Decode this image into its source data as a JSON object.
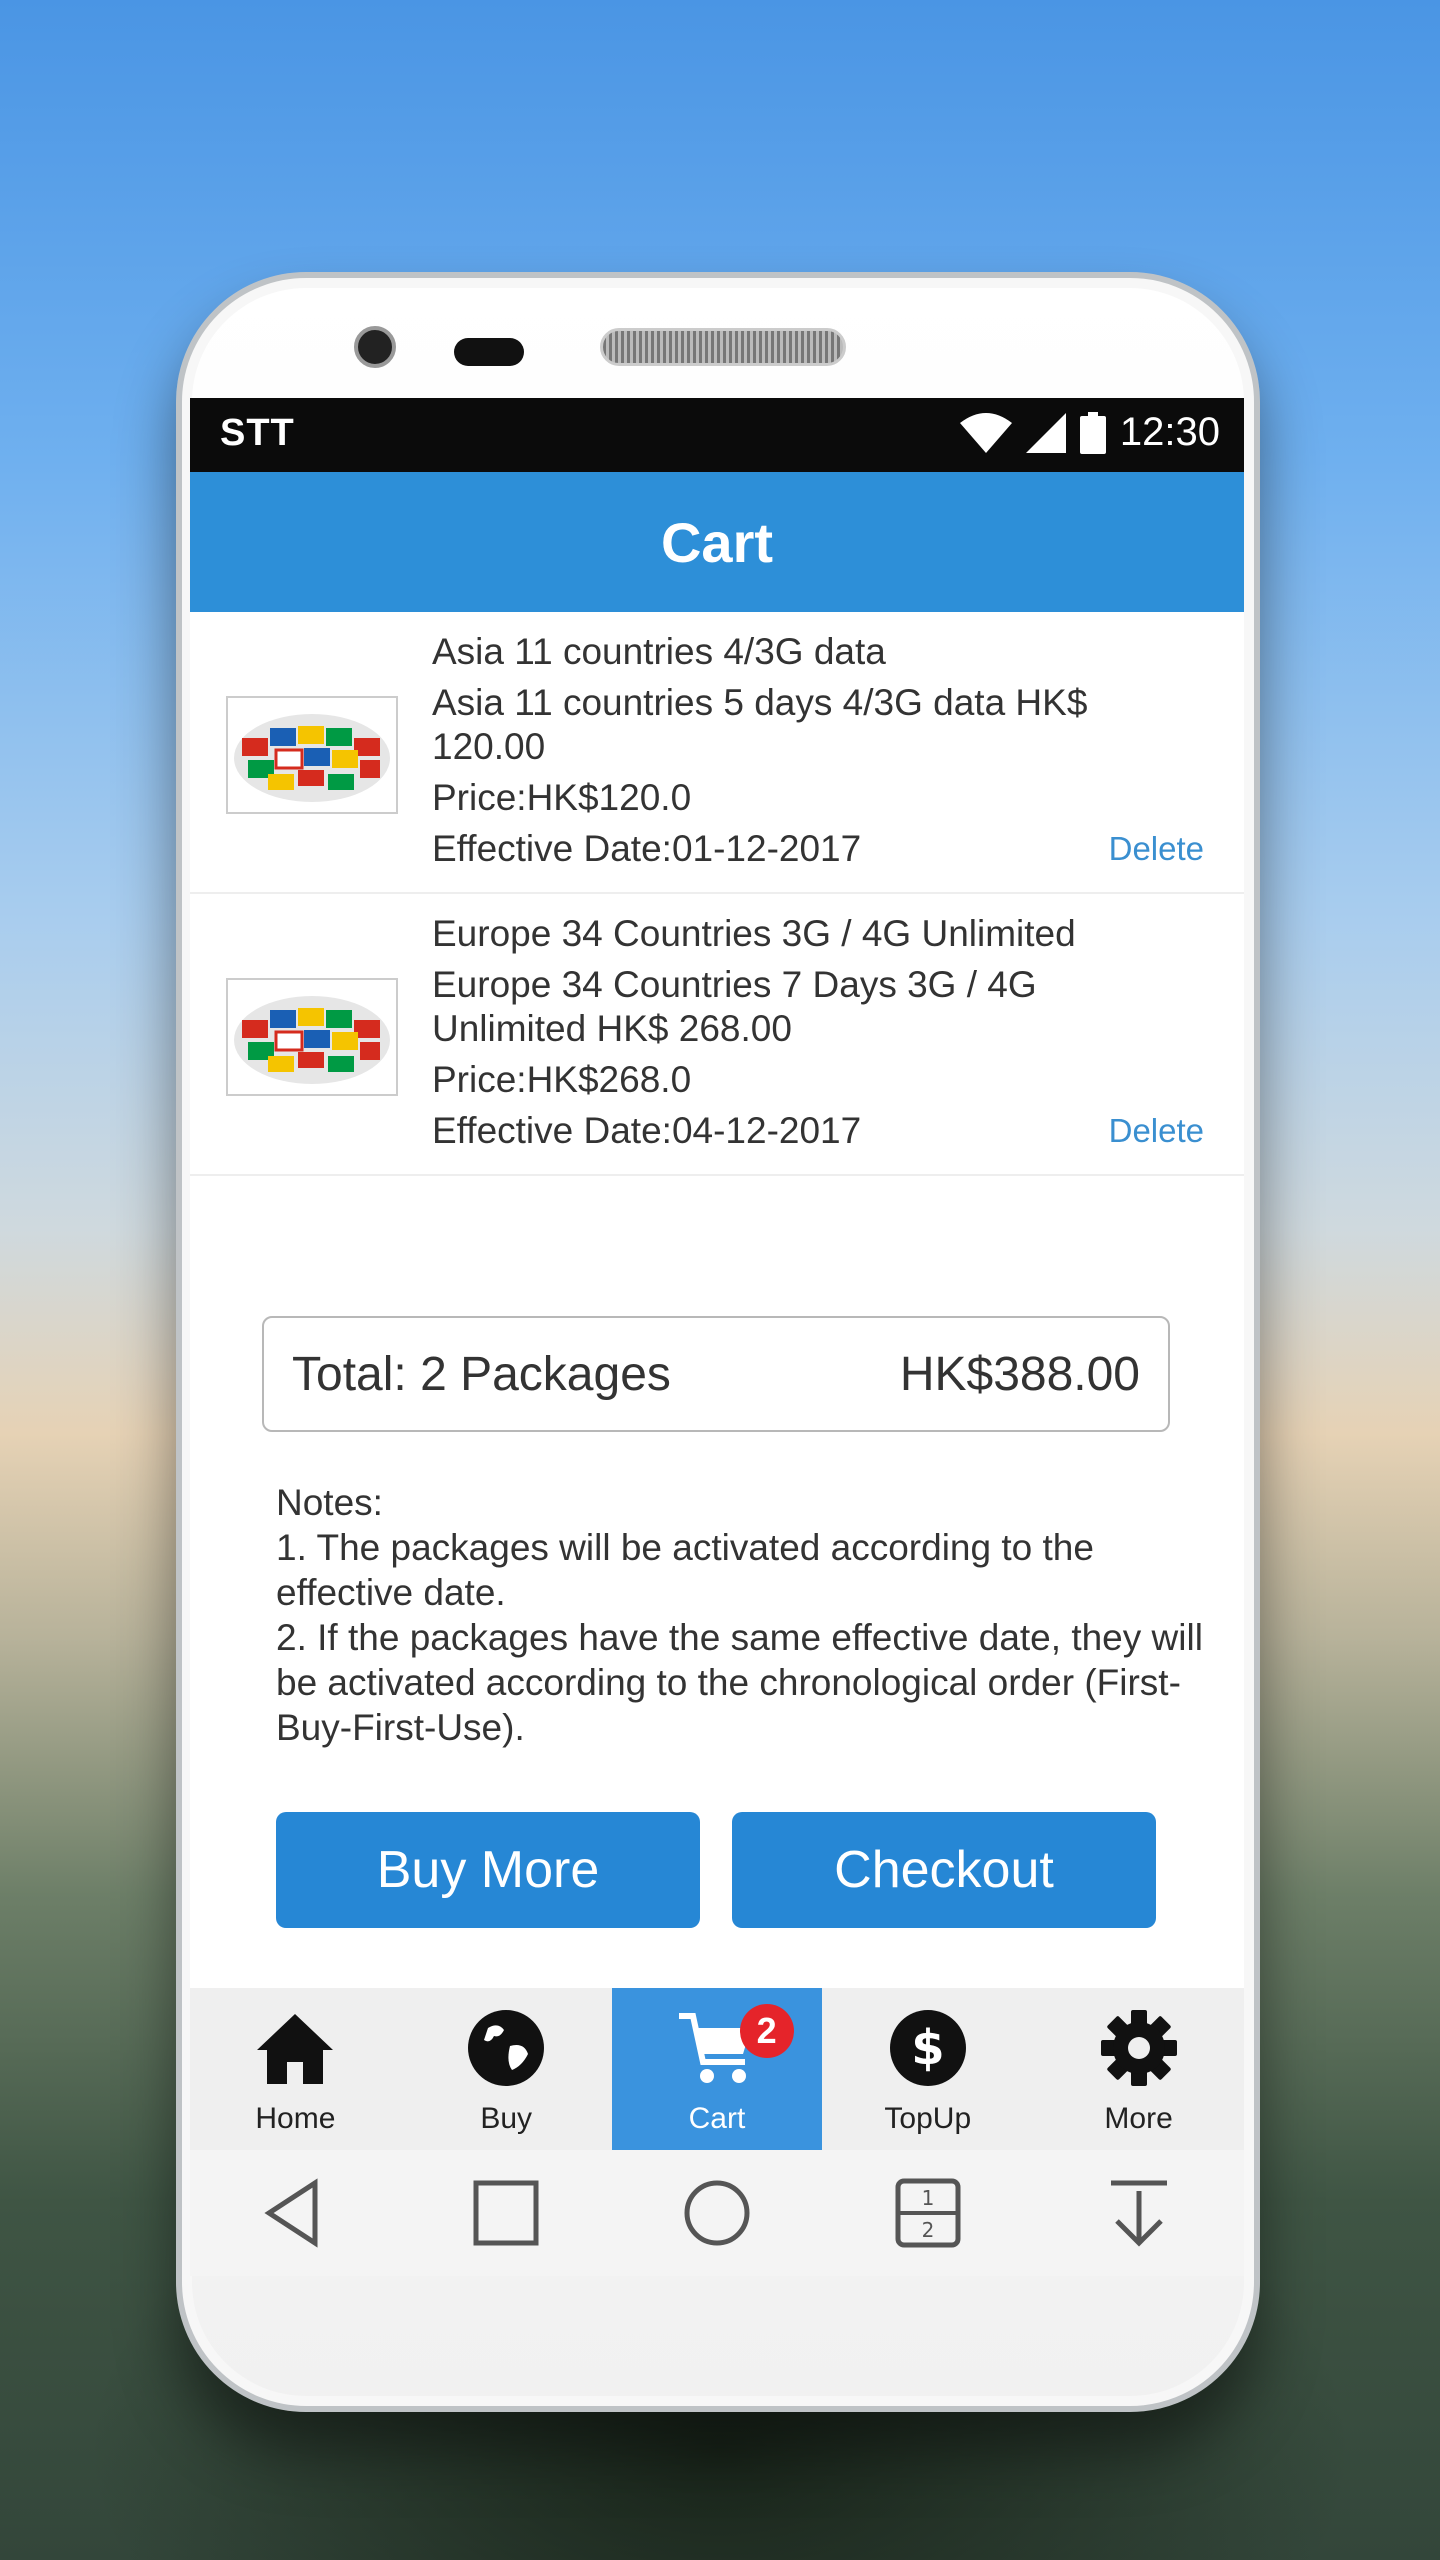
{
  "status": {
    "carrier": "STT",
    "time": "12:30"
  },
  "appbar": {
    "title": "Cart"
  },
  "cart": {
    "items": [
      {
        "title": "Asia 11 countries 4/3G data",
        "description": "Asia 11 countries 5 days 4/3G data HK$ 120.00",
        "price": "Price:HK$120.0",
        "effective": "Effective Date:01-12-2017",
        "delete_label": "Delete"
      },
      {
        "title": "Europe 34 Countries 3G / 4G Unlimited",
        "description": "Europe 34 Countries 7 Days 3G / 4G Unlimited HK$ 268.00",
        "price": "Price:HK$268.0",
        "effective": "Effective Date:04-12-2017",
        "delete_label": "Delete"
      }
    ],
    "total_label": "Total: 2 Packages",
    "total_amount": "HK$388.00"
  },
  "notes": {
    "heading": "Notes:",
    "line1": "1. The packages will be activated according to the effective date.",
    "line2": "2. If the packages have the same effective date, they will be activated according to the chronological order (First-Buy-First-Use)."
  },
  "buttons": {
    "buy_more": "Buy More",
    "checkout": "Checkout"
  },
  "tabs": [
    {
      "label": "Home",
      "icon": "home-icon"
    },
    {
      "label": "Buy",
      "icon": "globe-icon"
    },
    {
      "label": "Cart",
      "icon": "cart-icon",
      "badge": "2",
      "active": true
    },
    {
      "label": "TopUp",
      "icon": "dollar-icon"
    },
    {
      "label": "More",
      "icon": "gear-icon"
    }
  ],
  "colors": {
    "accent": "#2d8fd8",
    "button": "#2687d5",
    "badge": "#e5242a",
    "link": "#3a8fd0"
  }
}
